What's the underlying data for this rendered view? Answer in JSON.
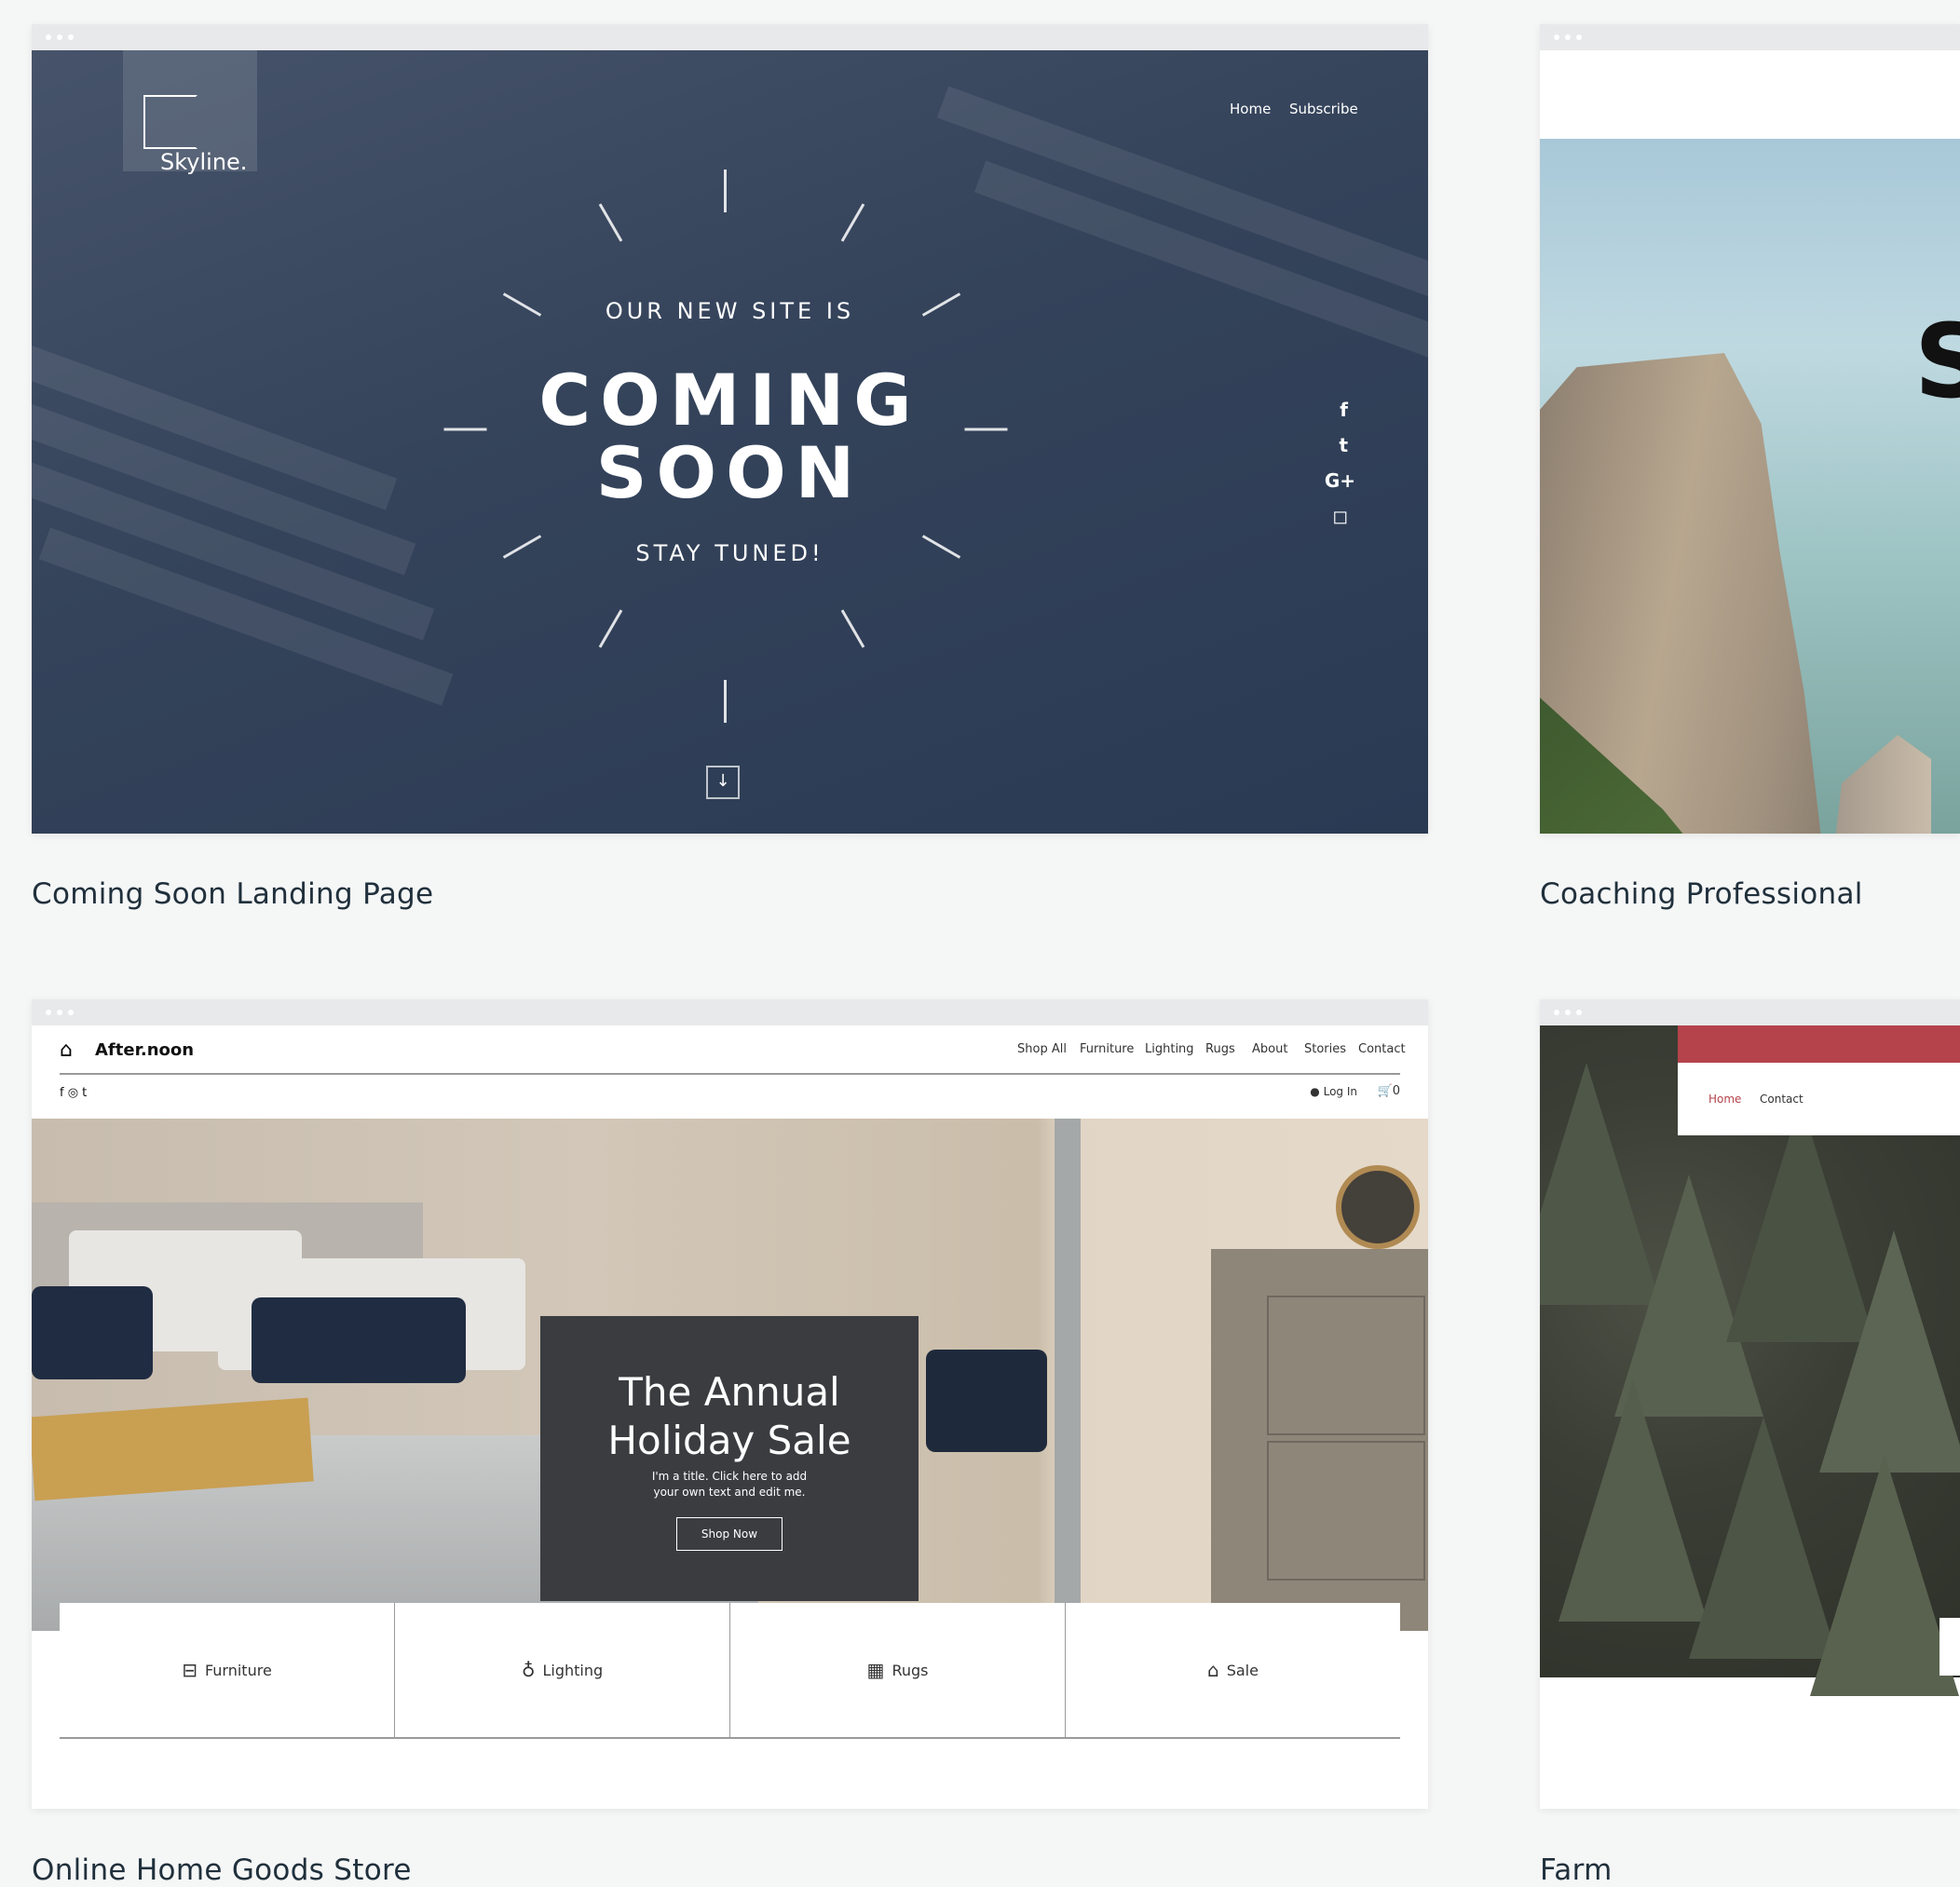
{
  "cards": [
    {
      "caption": "Coming Soon Landing Page",
      "preview": {
        "logo": "Skyline.",
        "nav": [
          "Home",
          "Subscribe"
        ],
        "line1": "OUR NEW SITE IS",
        "headline1": "COMING",
        "headline2": "SOON",
        "line2": "STAY TUNED!",
        "social_icons": [
          "facebook-icon",
          "twitter-icon",
          "google-plus-icon",
          "instagram-icon"
        ],
        "colors": {
          "background": "#34435a"
        }
      }
    },
    {
      "caption": "Coaching Professional",
      "preview": {
        "letter": "S"
      }
    },
    {
      "caption": "Online Home Goods Store",
      "preview": {
        "logo": "After.noon",
        "nav": [
          "Shop All",
          "Furniture",
          "Lighting",
          "Rugs",
          "About",
          "Stories",
          "Contact"
        ],
        "login": "Log In",
        "cart_count": "0",
        "hero_title": "The Annual Holiday Sale",
        "hero_sub": "I'm a title. Click here to add your own text and edit me.",
        "hero_button": "Shop Now",
        "categories": [
          {
            "label": "Furniture",
            "icon": "furniture-icon"
          },
          {
            "label": "Lighting",
            "icon": "lamp-icon"
          },
          {
            "label": "Rugs",
            "icon": "rug-icon"
          },
          {
            "label": "Sale",
            "icon": "tag-icon"
          }
        ],
        "colors": {
          "hero_box": "#3a3c40"
        }
      }
    },
    {
      "caption": "Farm",
      "preview": {
        "nav": [
          "Home",
          "Contact"
        ],
        "colors": {
          "header_accent": "#b5434b",
          "nav_active": "#b5434b"
        }
      }
    }
  ]
}
